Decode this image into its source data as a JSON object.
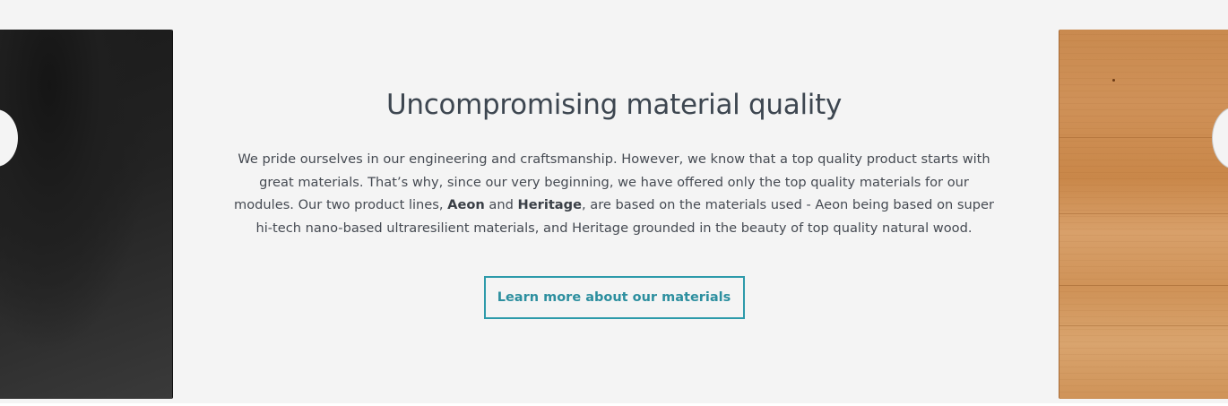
{
  "section": {
    "title": "Uncompromising material quality",
    "paragraph": {
      "part1": "We pride ourselves in our engineering and craftsmanship. However, we know that a top quality product starts with great materials. That’s why, since our very beginning, we have offered only the top quality materials for our modules. Our two product lines, ",
      "bold1": "Aeon",
      "part2": " and ",
      "bold2": "Heritage",
      "part3": ", are based on the materials used - Aeon being based on super hi-tech nano-based ultraresilient materials, and Heritage grounded in the beauty of top quality natural wood."
    },
    "cta_label": "Learn more about our materials"
  },
  "colors": {
    "background": "#f4f4f4",
    "heading": "#3d4650",
    "accent": "#2d9aaa",
    "dark_panel": "#1f1f1f",
    "wood_panel": "#cf9158"
  }
}
